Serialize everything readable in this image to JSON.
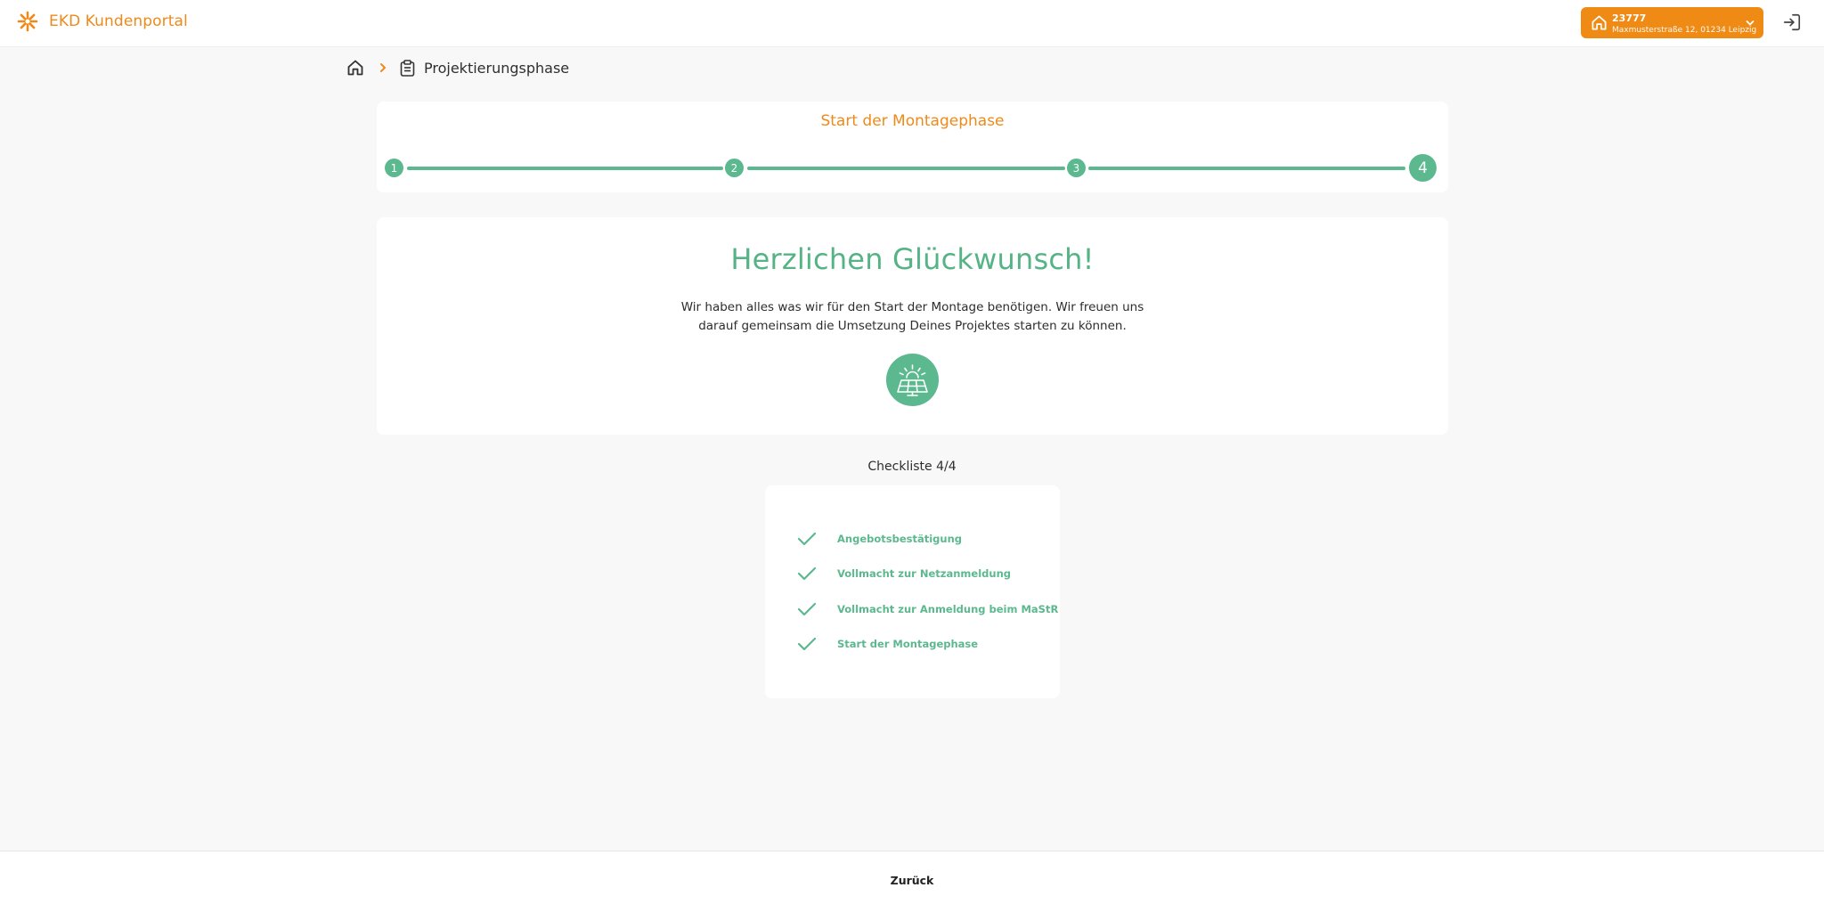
{
  "header": {
    "app_title": "EKD Kundenportal",
    "address_id": "23777",
    "address_line": "Maxmusterstraße 12, 01234 Leipzig"
  },
  "breadcrumb": {
    "current": "Projektierungsphase"
  },
  "stepper": {
    "phase_title": "Start der Montagephase",
    "steps": [
      "1",
      "2",
      "3",
      "4"
    ],
    "active_step": 4
  },
  "congrats": {
    "title": "Herzlichen Glückwunsch!",
    "text_line1": "Wir haben alles was wir für den Start der Montage benötigen. Wir freuen uns",
    "text_line2": "darauf gemeinsam die Umsetzung Deines Projektes starten zu können."
  },
  "checklist": {
    "heading": "Checkliste 4/4",
    "items": [
      "Angebotsbestätigung",
      "Vollmacht zur Netzanmeldung",
      "Vollmacht zur Anmeldung beim MaStR",
      "Start der Montagephase"
    ]
  },
  "footer": {
    "back_label": "Zurück"
  },
  "colors": {
    "brand_orange": "#ef8a1a",
    "success_green": "#5cb88e",
    "background": "#f8f8f8"
  },
  "icons": [
    "sun-logo-icon",
    "home-icon",
    "chevron-down-icon",
    "logout-icon",
    "chevron-right-icon",
    "clipboard-icon",
    "solar-panel-icon",
    "check-icon"
  ]
}
